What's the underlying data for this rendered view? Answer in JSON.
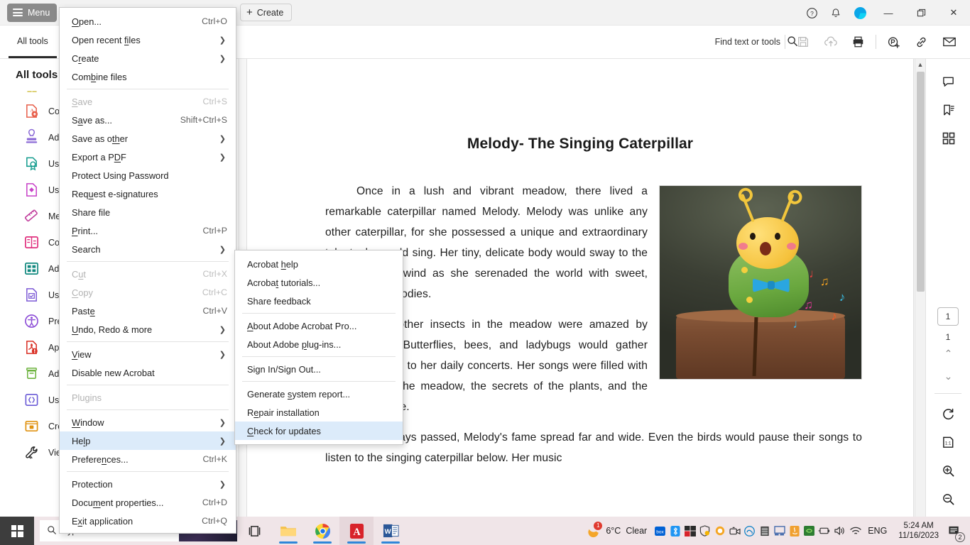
{
  "titlebar": {
    "menu_label": "Menu",
    "create_label": "Create",
    "help_icon": "help-circle-icon",
    "bell_icon": "bell-icon",
    "avatar_icon": "account-avatar",
    "minimize_label": "—",
    "maximize_label": "❐",
    "close_label": "✕"
  },
  "toolbar": {
    "all_tools_tab": "All tools",
    "find_placeholder": "Find text or tools",
    "icons": [
      "search-icon",
      "save-icon",
      "upload-cloud-icon",
      "print-icon",
      "stamp-add-icon",
      "link-icon",
      "mail-icon"
    ]
  },
  "sidebar": {
    "title": "All tools",
    "items": [
      {
        "label": "Co",
        "icon": "convert-pdf-icon",
        "color": "#e8604c"
      },
      {
        "label": "Ad",
        "icon": "stamp-icon",
        "color": "#8b6ad6"
      },
      {
        "label": "Use",
        "icon": "certificate-icon",
        "color": "#149c8e"
      },
      {
        "label": "Use",
        "icon": "protect-file-icon",
        "color": "#c842c8"
      },
      {
        "label": "Me",
        "icon": "measure-ruler-icon",
        "color": "#c0399a"
      },
      {
        "label": "Co",
        "icon": "compare-files-icon",
        "color": "#e0307e"
      },
      {
        "label": "Ad",
        "icon": "media-frames-icon",
        "color": "#12897f"
      },
      {
        "label": "Use",
        "icon": "form-file-icon",
        "color": "#7d5bd6"
      },
      {
        "label": "Pre",
        "icon": "accessibility-icon",
        "color": "#8b4ad6"
      },
      {
        "label": "App",
        "icon": "pdf-alert-icon",
        "color": "#d93025"
      },
      {
        "label": "Ad",
        "icon": "archive-box-icon",
        "color": "#6db33f"
      },
      {
        "label": "Use",
        "icon": "javascript-braces-icon",
        "color": "#6a5bd6"
      },
      {
        "label": "Cre",
        "icon": "presentation-icon",
        "color": "#e09313"
      },
      {
        "label": "Vie",
        "icon": "tool-wrench-icon",
        "color": "#1f1f1f"
      }
    ]
  },
  "menu": {
    "items": [
      {
        "label": "Open...",
        "accel": "Ctrl+O",
        "type": "item",
        "underline": "O"
      },
      {
        "label": "Open recent files",
        "accel": "",
        "type": "submenu",
        "underline": "fi"
      },
      {
        "label": "Create",
        "accel": "",
        "type": "submenu",
        "underline": "r"
      },
      {
        "label": "Combine files",
        "accel": "",
        "type": "item",
        "underline": "b"
      },
      {
        "type": "separator"
      },
      {
        "label": "Save",
        "accel": "Ctrl+S",
        "type": "item",
        "disabled": true,
        "underline": "S"
      },
      {
        "label": "Save as...",
        "accel": "Shift+Ctrl+S",
        "type": "item",
        "underline": "a"
      },
      {
        "label": "Save as other",
        "accel": "",
        "type": "submenu",
        "underline": "th"
      },
      {
        "label": "Export a PDF",
        "accel": "",
        "type": "submenu",
        "underline": "D"
      },
      {
        "label": "Protect Using Password",
        "accel": "",
        "type": "item"
      },
      {
        "label": "Request e-signatures",
        "accel": "",
        "type": "item",
        "underline": "u"
      },
      {
        "label": "Share file",
        "accel": "",
        "type": "item"
      },
      {
        "label": "Print...",
        "accel": "Ctrl+P",
        "type": "item",
        "underline": "P"
      },
      {
        "label": "Search",
        "accel": "",
        "type": "submenu"
      },
      {
        "type": "separator"
      },
      {
        "label": "Cut",
        "accel": "Ctrl+X",
        "type": "item",
        "disabled": true,
        "underline": "u"
      },
      {
        "label": "Copy",
        "accel": "Ctrl+C",
        "type": "item",
        "disabled": true,
        "underline": "C"
      },
      {
        "label": "Paste",
        "accel": "Ctrl+V",
        "type": "item",
        "underline": "e"
      },
      {
        "label": "Undo, Redo & more",
        "accel": "",
        "type": "submenu",
        "underline": "U"
      },
      {
        "type": "separator"
      },
      {
        "label": "View",
        "accel": "",
        "type": "submenu",
        "underline": "V"
      },
      {
        "label": "Disable new Acrobat",
        "accel": "",
        "type": "item"
      },
      {
        "type": "separator"
      },
      {
        "label": "Plugins",
        "accel": "",
        "type": "item",
        "disabled": true,
        "underline": "g"
      },
      {
        "type": "separator"
      },
      {
        "label": "Window",
        "accel": "",
        "type": "submenu",
        "underline": "W"
      },
      {
        "label": "Help",
        "accel": "",
        "type": "submenu",
        "selected": true,
        "underline": "l"
      },
      {
        "label": "Preferences...",
        "accel": "Ctrl+K",
        "type": "item",
        "underline": "n"
      },
      {
        "type": "separator"
      },
      {
        "label": "Protection",
        "accel": "",
        "type": "submenu"
      },
      {
        "label": "Document properties...",
        "accel": "Ctrl+D",
        "type": "item",
        "underline": "m"
      },
      {
        "label": "Exit application",
        "accel": "Ctrl+Q",
        "type": "item",
        "underline": "x"
      }
    ]
  },
  "submenu": {
    "items": [
      {
        "label": "Acrobat help",
        "type": "item",
        "underline": "h"
      },
      {
        "label": "Acrobat tutorials...",
        "type": "item",
        "underline": "t"
      },
      {
        "label": "Share feedback",
        "type": "item"
      },
      {
        "type": "separator"
      },
      {
        "label": "About Adobe Acrobat Pro...",
        "type": "item",
        "underline": "A"
      },
      {
        "label": "About Adobe plug-ins...",
        "type": "item",
        "underline": "p"
      },
      {
        "type": "separator"
      },
      {
        "label": "Sign In/Sign Out...",
        "type": "item"
      },
      {
        "type": "separator"
      },
      {
        "label": "Generate system report...",
        "type": "item",
        "underline": "s"
      },
      {
        "label": "Repair installation",
        "type": "item",
        "underline": "e"
      },
      {
        "label": "Check for updates",
        "type": "item",
        "selected": true,
        "underline": "C"
      }
    ]
  },
  "document": {
    "title": "Melody- The Singing Caterpillar",
    "paragraphs": [
      "Once in a lush and vibrant meadow, there lived a remarkable caterpillar named Melody. Melody was unlike any other caterpillar, for she possessed a unique and extraordinary talent: she could sing. Her tiny, delicate body would sway to the rhythm of the wind as she serenaded the world with sweet, enchanting melodies.",
      "All the other insects in the meadow were amazed by Melody's gift. Butterflies, bees, and ladybugs would gather around to listen to her daily concerts. Her songs were filled with the stories of the meadow, the secrets of the plants, and the beauty of nature.",
      "As the days passed, Melody's fame spread far and wide. Even the birds would pause their songs to listen to the singing caterpillar below. Her music"
    ],
    "image_alt": "singing-caterpillar-photo"
  },
  "rightrail": {
    "icons": [
      "comment-icon",
      "bookmark-icon",
      "thumbnails-icon"
    ],
    "page_current": "1",
    "page_total": "1",
    "nav_up": "⌃",
    "nav_down": "⌄",
    "tool_icons": [
      "rotate-icon",
      "fit-page-icon",
      "zoom-in-icon",
      "zoom-out-icon"
    ]
  },
  "taskbar": {
    "search_placeholder": "Type here to search",
    "apps": [
      "task-view-icon",
      "file-explorer-icon",
      "chrome-icon",
      "acrobat-icon",
      "word-icon"
    ],
    "weather_temp": "6°C",
    "weather_desc": "Clear",
    "weather_badge": "1",
    "tray_icons": [
      "box-icon",
      "bluetooth-icon",
      "office-icon",
      "security-shield-icon",
      "update-icon",
      "camera-icon",
      "onedrive-icon",
      "storage-icon",
      "display-icon",
      "java-icon",
      "nvidia-icon",
      "battery-icon",
      "volume-icon",
      "wifi-icon"
    ],
    "language": "ENG",
    "time": "5:24 AM",
    "date": "11/16/2023",
    "notification_count": "2"
  }
}
